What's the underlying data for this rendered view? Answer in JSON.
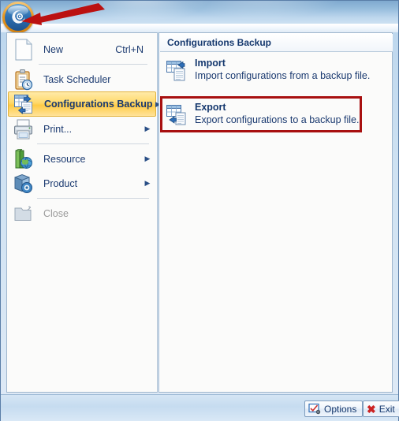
{
  "window": {
    "orb_icon": "application-orb-icon",
    "annotation_arrow": {
      "icon": "red-arrow-annotation",
      "color": "#bb1111",
      "points_to": "application-orb-button"
    }
  },
  "menu": {
    "items": [
      {
        "label": "New",
        "icon": "new-document-icon",
        "shortcut": "Ctrl+N",
        "submenu": false,
        "selected": false,
        "disabled": false,
        "separator_after": true
      },
      {
        "label": "Task Scheduler",
        "icon": "task-scheduler-clipboard-clock-icon",
        "shortcut": "",
        "submenu": false,
        "selected": false,
        "disabled": false,
        "separator_after": false
      },
      {
        "label": "Configurations Backup",
        "icon": "configurations-backup-icon",
        "shortcut": "",
        "submenu": true,
        "selected": true,
        "disabled": false,
        "separator_after": false
      },
      {
        "label": "Print...",
        "icon": "printer-icon",
        "shortcut": "",
        "submenu": true,
        "selected": false,
        "disabled": false,
        "separator_after": true
      },
      {
        "label": "Resource",
        "icon": "books-globe-icon",
        "shortcut": "",
        "submenu": true,
        "selected": false,
        "disabled": false,
        "separator_after": false
      },
      {
        "label": "Product",
        "icon": "product-box-icon",
        "shortcut": "",
        "submenu": true,
        "selected": false,
        "disabled": false,
        "separator_after": true
      },
      {
        "label": "Close",
        "icon": "close-folder-icon",
        "shortcut": "",
        "submenu": false,
        "selected": false,
        "disabled": true,
        "separator_after": false
      }
    ],
    "submenu_arrow_glyph": "▶"
  },
  "panel": {
    "header": "Configurations Backup",
    "items": [
      {
        "title": "Import",
        "description": "Import configurations from a backup file.",
        "icon": "import-table-arrow-icon",
        "highlighted": false
      },
      {
        "title": "Export",
        "description": "Export configurations to a backup file.",
        "icon": "export-table-arrow-icon",
        "highlighted": true
      }
    ],
    "highlight_color": "#a81010"
  },
  "footer": {
    "options_label": "Options",
    "options_icon": "options-checkbox-icon",
    "exit_label": "Exit",
    "exit_icon": "close-x-icon",
    "exit_icon_glyph": "✖"
  }
}
